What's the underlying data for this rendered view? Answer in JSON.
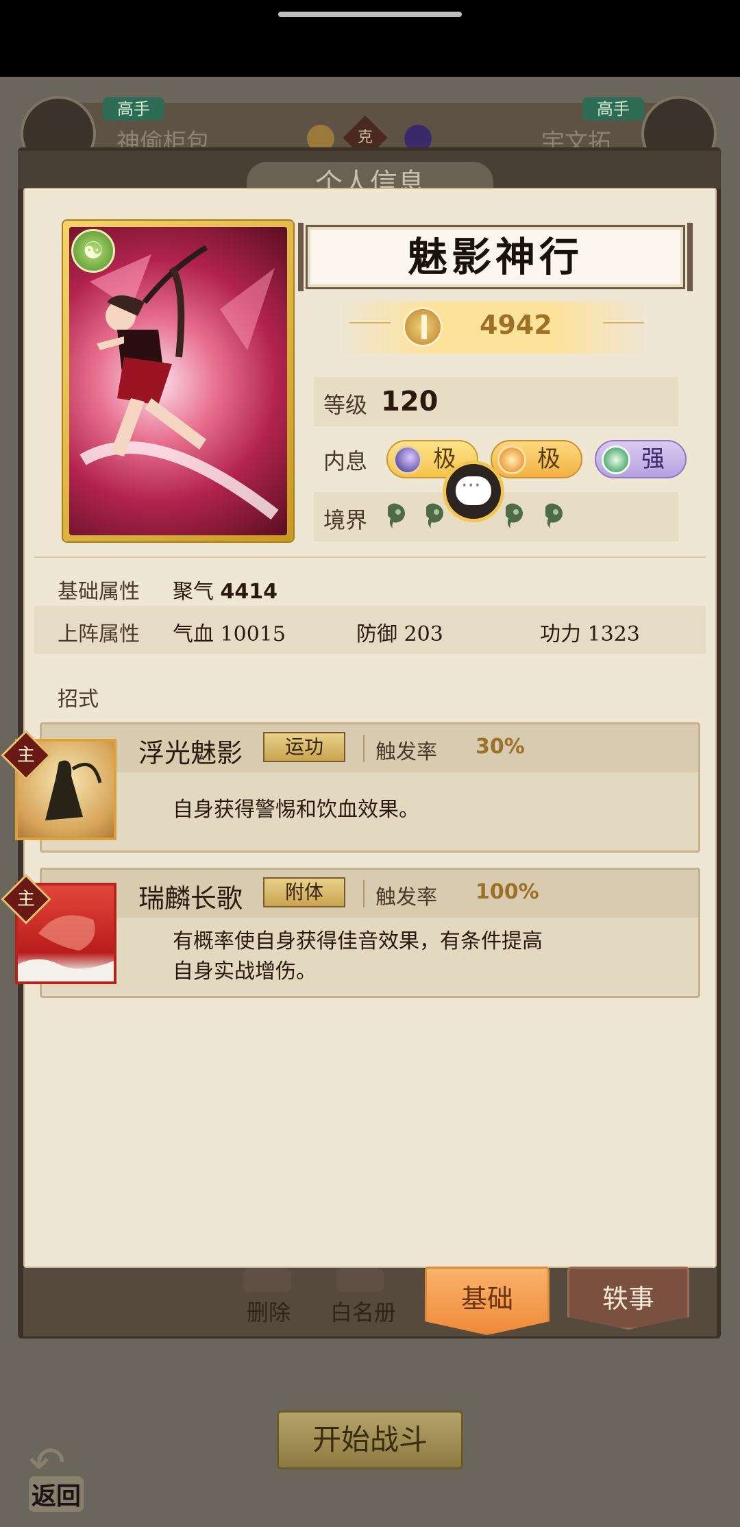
{
  "background": {
    "left_rank": "高手",
    "left_name": "神偷柜包",
    "right_rank": "高手",
    "right_name": "宇文拓",
    "vs_label": "克"
  },
  "modal": {
    "title": "个人信息"
  },
  "hero": {
    "name": "魅影神行",
    "power": "4942",
    "level_label": "等级",
    "level": "120",
    "inner_label": "内息",
    "inner": [
      {
        "grade": "极",
        "icon": "moon-orb-icon"
      },
      {
        "grade": "极",
        "icon": "sun-orb-icon"
      },
      {
        "grade": "强",
        "icon": "jade-orb-icon"
      }
    ],
    "realm_label": "境界",
    "realm_icon": "magatama-icon"
  },
  "attributes": {
    "base_label": "基础属性",
    "base_stat_name": "聚气",
    "base_stat_value": "4414",
    "battle_label": "上阵属性",
    "hp_name": "气血",
    "hp_value": "10015",
    "def_name": "防御",
    "def_value": "203",
    "atk_name": "功力",
    "atk_value": "1323"
  },
  "moves": {
    "label": "招式",
    "items": [
      {
        "main_tag": "主",
        "name": "浮光魅影",
        "type": "运功",
        "rate_label": "触发率",
        "rate": "30%",
        "desc": "自身获得警惕和饮血效果。"
      },
      {
        "main_tag": "主",
        "name": "瑞麟长歌",
        "type": "附体",
        "rate_label": "触发率",
        "rate": "100%",
        "desc_line1": "有概率使自身获得佳音效果，有条件提高",
        "desc_line2": "自身实战增伤。"
      }
    ]
  },
  "bottom_bar": {
    "delete_label": "删除",
    "whitelist_label": "白名册"
  },
  "tabs": {
    "basic": "基础",
    "story": "轶事"
  },
  "actions": {
    "start_battle": "开始战斗",
    "back": "返回"
  },
  "colors": {
    "panel": "#efe6d3",
    "accent_gold": "#9d7028",
    "tab_active": "#ef8b3a",
    "tab_inactive": "#7a5040"
  }
}
